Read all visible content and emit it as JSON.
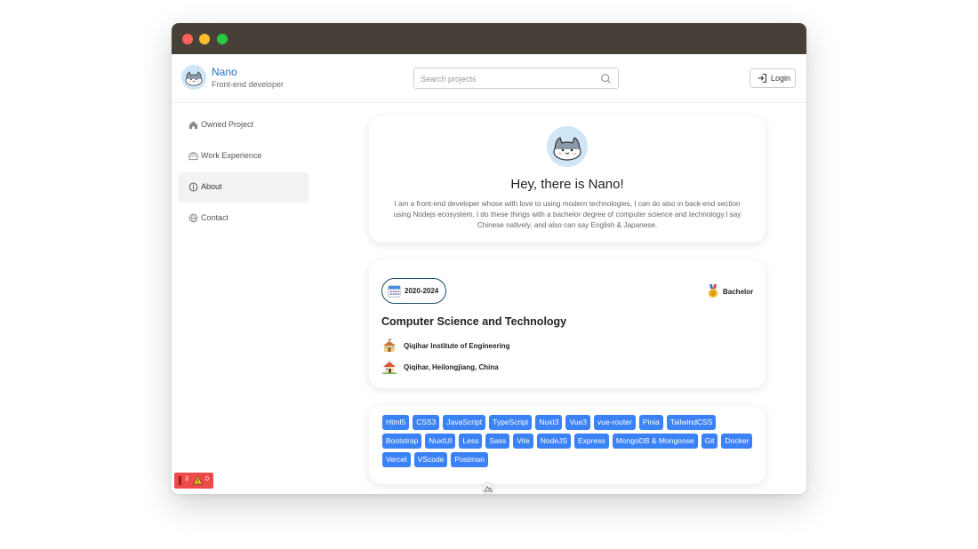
{
  "header": {
    "name": "Nano",
    "subtitle": "Front-end developer",
    "search_placeholder": "Search projects",
    "login_label": "Login"
  },
  "sidebar": {
    "items": [
      {
        "label": "Owned Project",
        "icon": "home-icon"
      },
      {
        "label": "Work Experience",
        "icon": "briefcase-icon"
      },
      {
        "label": "About",
        "icon": "info-icon",
        "active": true
      },
      {
        "label": "Contact",
        "icon": "globe-icon"
      }
    ]
  },
  "hero": {
    "title": "Hey, there is Nano!",
    "description": "I am a front-end developer whose with love to using modern technologies, I can do also in back-end section using Nodejs ecosystem. I do these things with a bachelor degree of computer science and technology.I say Chinese natively, and also can say English & Japanese."
  },
  "education": {
    "years": "2020-2024",
    "degree": "Bachelor",
    "major": "Computer Science and Technology",
    "school": "Qiqihar Institute of Engineering",
    "location": "Qiqihar, Heilongjiang, China"
  },
  "skills": [
    "Html5",
    "CSS3",
    "JavaScript",
    "TypeScript",
    "Nuxt3",
    "Vue3",
    "vue-router",
    "Pinia",
    "TailwindCSS",
    "Bootstrap",
    "NuxtUI",
    "Less",
    "Sass",
    "Vite",
    "NodeJS",
    "Express",
    "MongoDB & Mongoose",
    "Git",
    "Docker",
    "Vercel",
    "VScode",
    "Postman"
  ],
  "status": {
    "errors": "3",
    "warnings": "0"
  },
  "colors": {
    "brand": "#1e73c8",
    "tag": "#3b82f6",
    "titlebar": "#474039"
  }
}
